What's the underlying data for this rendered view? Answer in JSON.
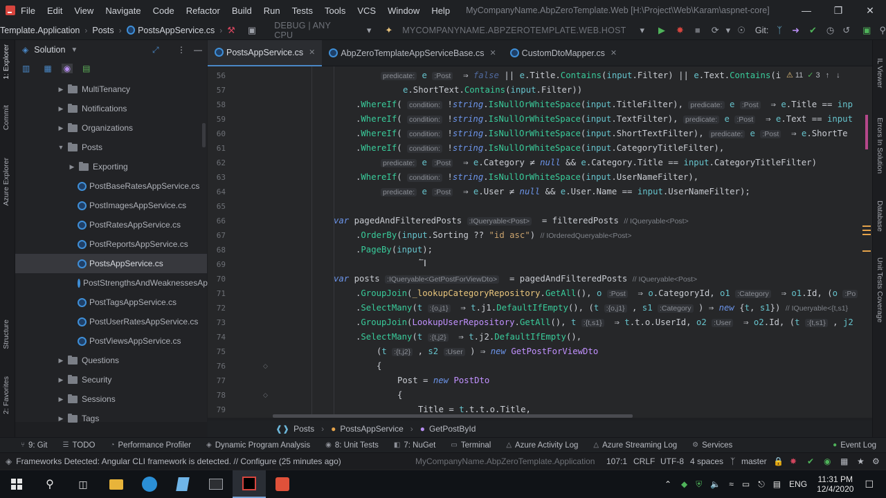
{
  "menu": {
    "items": [
      "File",
      "Edit",
      "View",
      "Navigate",
      "Code",
      "Refactor",
      "Build",
      "Run",
      "Tests",
      "Tools",
      "VCS",
      "Window",
      "Help"
    ],
    "title": "MyCompanyName.AbpZeroTemplate.Web [H:\\Project\\Web\\Karam\\aspnet-core]"
  },
  "toolbar": {
    "crumb1": "Template.Application",
    "crumb2": "Posts",
    "crumb3": "PostsAppService.cs",
    "config": "DEBUG | ANY CPU",
    "project": "MYCOMPANYNAME.ABPZEROTEMPLATE.WEB.HOST",
    "git_label": "Git:"
  },
  "left_strip": {
    "explorer": "1: Explorer",
    "commit": "Commit",
    "azure": "Azure Explorer",
    "structure": "Structure",
    "favorites": "2: Favorites"
  },
  "right_strip": {
    "il_viewer": "IL Viewer",
    "errors": "Errors In Solution",
    "database": "Database",
    "coverage": "Unit Tests Coverage"
  },
  "explorer": {
    "title": "Solution",
    "items": [
      {
        "label": "MultiTenancy",
        "type": "folder",
        "expanded": false
      },
      {
        "label": "Notifications",
        "type": "folder",
        "expanded": false
      },
      {
        "label": "Organizations",
        "type": "folder",
        "expanded": false
      },
      {
        "label": "Posts",
        "type": "folder",
        "expanded": true
      },
      {
        "label": "Exporting",
        "type": "folder",
        "expanded": false
      },
      {
        "label": "PostBaseRatesAppService.cs",
        "type": "file"
      },
      {
        "label": "PostImagesAppService.cs",
        "type": "file"
      },
      {
        "label": "PostRatesAppService.cs",
        "type": "file"
      },
      {
        "label": "PostReportsAppService.cs",
        "type": "file"
      },
      {
        "label": "PostsAppService.cs",
        "type": "file",
        "selected": true
      },
      {
        "label": "PostStrengthsAndWeaknessesAp",
        "type": "file"
      },
      {
        "label": "PostTagsAppService.cs",
        "type": "file"
      },
      {
        "label": "PostUserRatesAppService.cs",
        "type": "file"
      },
      {
        "label": "PostViewsAppService.cs",
        "type": "file"
      },
      {
        "label": "Questions",
        "type": "folder",
        "expanded": false
      },
      {
        "label": "Security",
        "type": "folder",
        "expanded": false
      },
      {
        "label": "Sessions",
        "type": "folder",
        "expanded": false
      },
      {
        "label": "Tags",
        "type": "folder",
        "expanded": false
      }
    ]
  },
  "tabs": [
    {
      "label": "PostsAppService.cs",
      "active": true
    },
    {
      "label": "AbpZeroTemplateAppServiceBase.cs",
      "active": false
    },
    {
      "label": "CustomDtoMapper.cs",
      "active": false
    }
  ],
  "editor": {
    "line_numbers": [
      "56",
      "57",
      "58",
      "59",
      "60",
      "61",
      "62",
      "63",
      "64",
      "65",
      "66",
      "67",
      "68",
      "69",
      "70",
      "71",
      "72",
      "73",
      "74",
      "75",
      "76",
      "77",
      "78",
      "79"
    ],
    "inspection": {
      "warnings": "11",
      "ok": "3"
    }
  },
  "editor_breadcrumbs": [
    "Posts",
    "PostsAppService",
    "GetPostById"
  ],
  "tool_windows": [
    {
      "label": "9: Git",
      "icon": "git-icon"
    },
    {
      "label": "TODO",
      "icon": "list-icon"
    },
    {
      "label": "Performance Profiler",
      "icon": "profiler-icon"
    },
    {
      "label": "Dynamic Program Analysis",
      "icon": "analysis-icon"
    },
    {
      "label": "8: Unit Tests",
      "icon": "tests-icon"
    },
    {
      "label": "7: NuGet",
      "icon": "nuget-icon"
    },
    {
      "label": "Terminal",
      "icon": "terminal-icon"
    },
    {
      "label": "Azure Activity Log",
      "icon": "azure-icon"
    },
    {
      "label": "Azure Streaming Log",
      "icon": "azure-icon"
    },
    {
      "label": "Services",
      "icon": "services-icon"
    }
  ],
  "event_log": "Event Log",
  "status": {
    "message": "Frameworks Detected: Angular CLI framework is detected. // Configure (25 minutes ago)",
    "project": "MyCompanyName.AbpZeroTemplate.Application",
    "position": "107:1",
    "line_ending": "CRLF",
    "encoding": "UTF-8",
    "indent": "4 spaces",
    "branch": "master"
  },
  "taskbar": {
    "time": "11:31 PM",
    "date": "12/4/2020",
    "lang": "ENG"
  },
  "colors": {
    "keyword": "#6c95eb",
    "method": "#39cc9b",
    "type": "#c191ff",
    "string": "#c9a26d",
    "accent": "#4a88c7"
  }
}
